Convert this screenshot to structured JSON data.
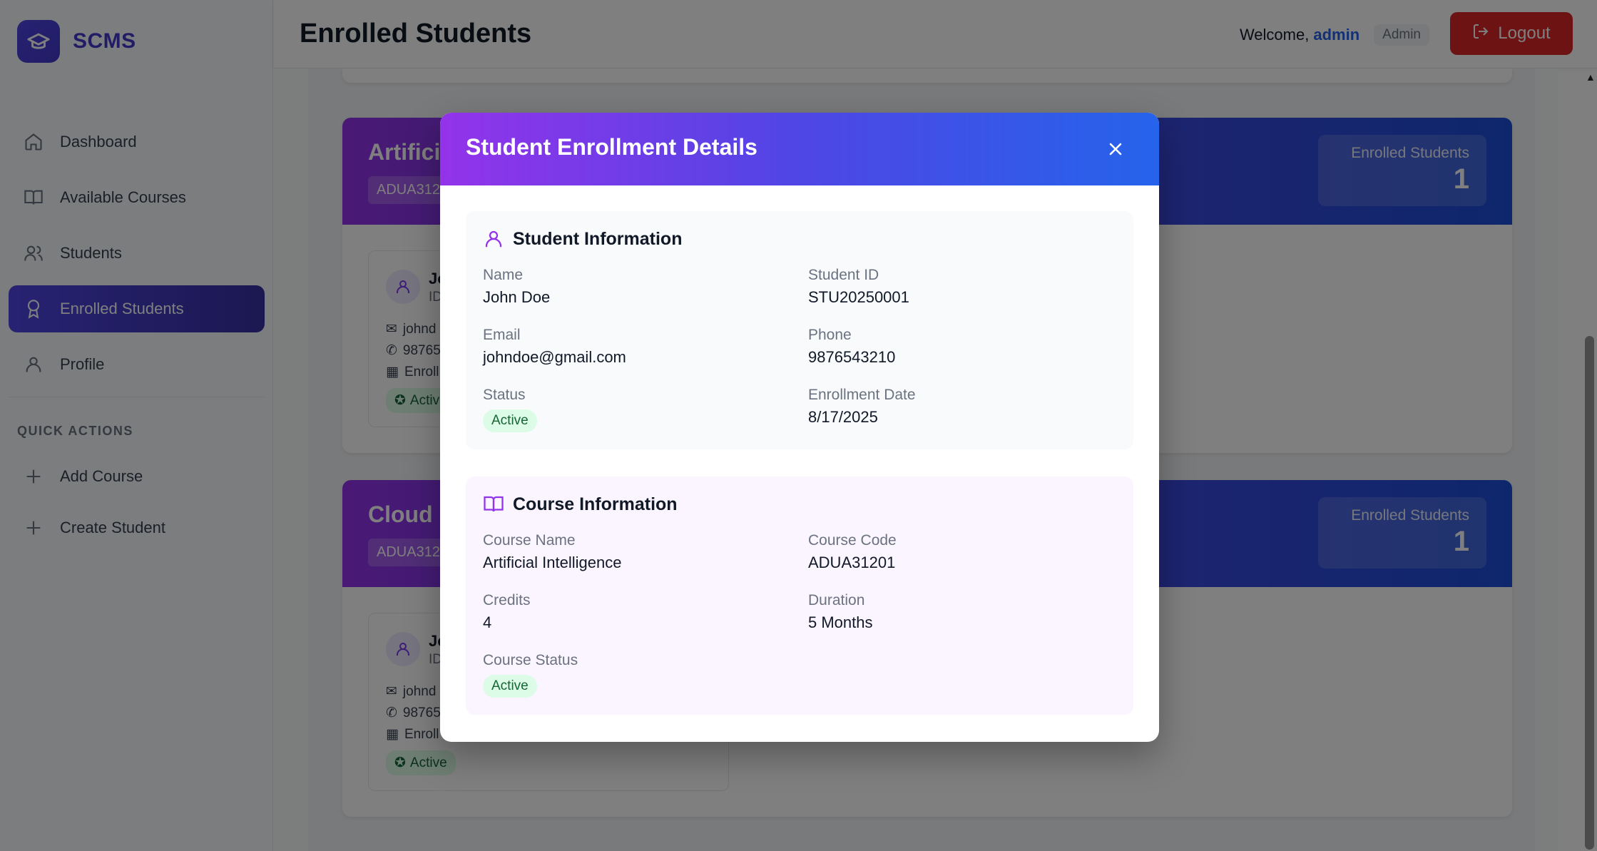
{
  "app": {
    "name": "SCMS"
  },
  "sidebar": {
    "items": [
      {
        "label": "Dashboard",
        "icon": "home-icon"
      },
      {
        "label": "Available Courses",
        "icon": "book-open-icon"
      },
      {
        "label": "Students",
        "icon": "users-icon"
      },
      {
        "label": "Enrolled Students",
        "icon": "award-icon",
        "active": true
      },
      {
        "label": "Profile",
        "icon": "user-icon"
      }
    ],
    "quick_actions_label": "QUICK ACTIONS",
    "quick_actions": [
      {
        "label": "Add Course",
        "icon": "plus-icon"
      },
      {
        "label": "Create Student",
        "icon": "plus-icon"
      }
    ]
  },
  "header": {
    "title": "Enrolled Students",
    "welcome": "Welcome,",
    "username": "admin",
    "role": "Admin",
    "logout_label": "Logout"
  },
  "cards": [
    {
      "title": "Artifici",
      "code": "ADUA312",
      "enrolled_label": "Enrolled Students",
      "enrolled_count": "1",
      "student": {
        "name": "Jo",
        "id": "ID",
        "email": "johnd",
        "phone": "98765",
        "enrolled": "Enroll",
        "status": "Activ"
      }
    },
    {
      "title": "Cloud",
      "code": "ADUA312",
      "enrolled_label": "Enrolled Students",
      "enrolled_count": "1",
      "student": {
        "name": "Jo",
        "id": "ID",
        "email": "johnd",
        "phone": "98765",
        "enrolled": "Enroll",
        "status": "Active"
      }
    }
  ],
  "modal": {
    "title": "Student Enrollment Details",
    "student_section": {
      "heading": "Student Information",
      "name_label": "Name",
      "name": "John Doe",
      "id_label": "Student ID",
      "id": "STU20250001",
      "email_label": "Email",
      "email": "johndoe@gmail.com",
      "phone_label": "Phone",
      "phone": "9876543210",
      "status_label": "Status",
      "status": "Active",
      "date_label": "Enrollment Date",
      "date": "8/17/2025"
    },
    "course_section": {
      "heading": "Course Information",
      "name_label": "Course Name",
      "name": "Artificial Intelligence",
      "code_label": "Course Code",
      "code": "ADUA31201",
      "credits_label": "Credits",
      "credits": "4",
      "duration_label": "Duration",
      "duration": "5 Months",
      "status_label": "Course Status",
      "status": "Active"
    }
  },
  "colors": {
    "accent": "#4f46e5",
    "purple": "#9333ea",
    "logout": "#dc2626",
    "success_bg": "#dcfce7",
    "success_text": "#166534"
  }
}
